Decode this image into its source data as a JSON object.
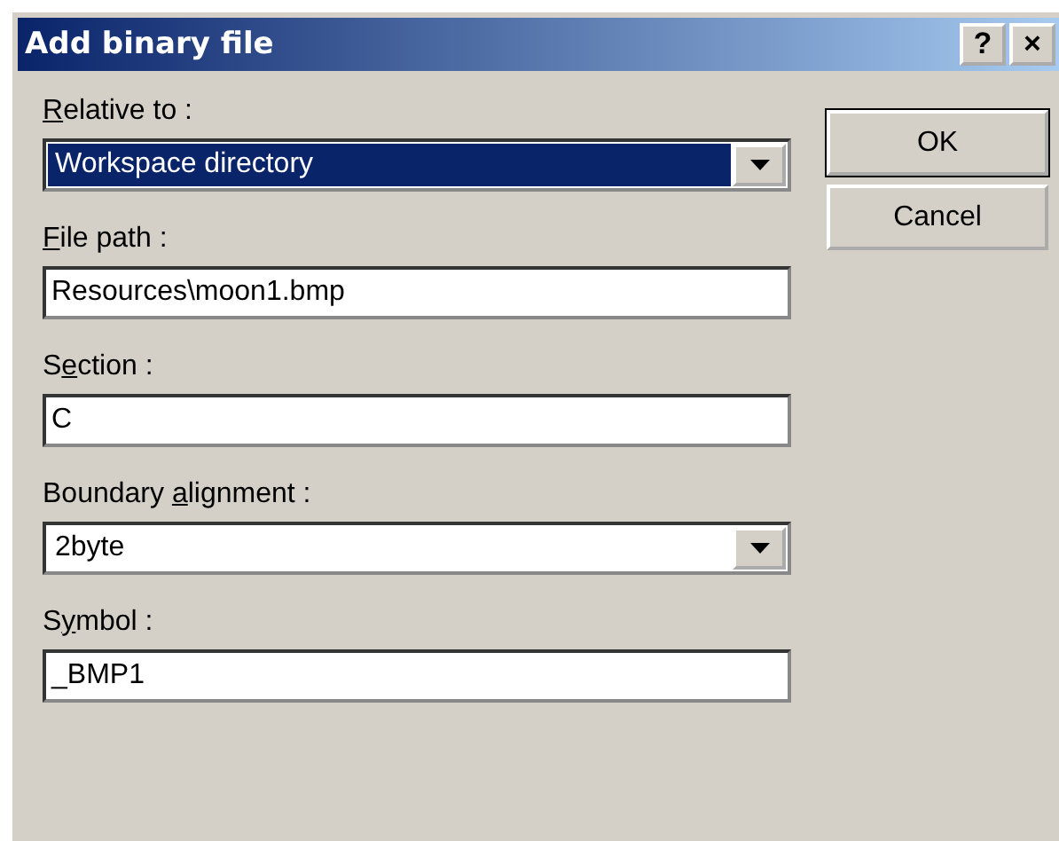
{
  "window": {
    "title": "Add binary file",
    "title_buttons": [
      "?",
      "×"
    ]
  },
  "fields": [
    {
      "kind": "dropdown",
      "access_key": "R",
      "label_end": "elative to :",
      "value": "Workspace directory",
      "highlighted": true
    },
    {
      "kind": "text",
      "access_key": "F",
      "label_end": "ile path :",
      "value": "Resources\\moon1.bmp",
      "highlighted": false
    },
    {
      "kind": "text",
      "label_start": "S",
      "access_key": "e",
      "label_end": "ction :",
      "value": "C",
      "highlighted": false
    },
    {
      "kind": "dropdown",
      "label_start": "Boundary ",
      "access_key": "a",
      "label_end": "lignment :",
      "value": "2byte",
      "highlighted": false
    },
    {
      "kind": "text",
      "label_start": "S",
      "access_key": "y",
      "label_end": "mbol :",
      "value": "_BMP1",
      "highlighted": false
    }
  ],
  "buttons": [
    {
      "label": "OK",
      "default": true
    },
    {
      "label": "Cancel",
      "default": false
    }
  ]
}
